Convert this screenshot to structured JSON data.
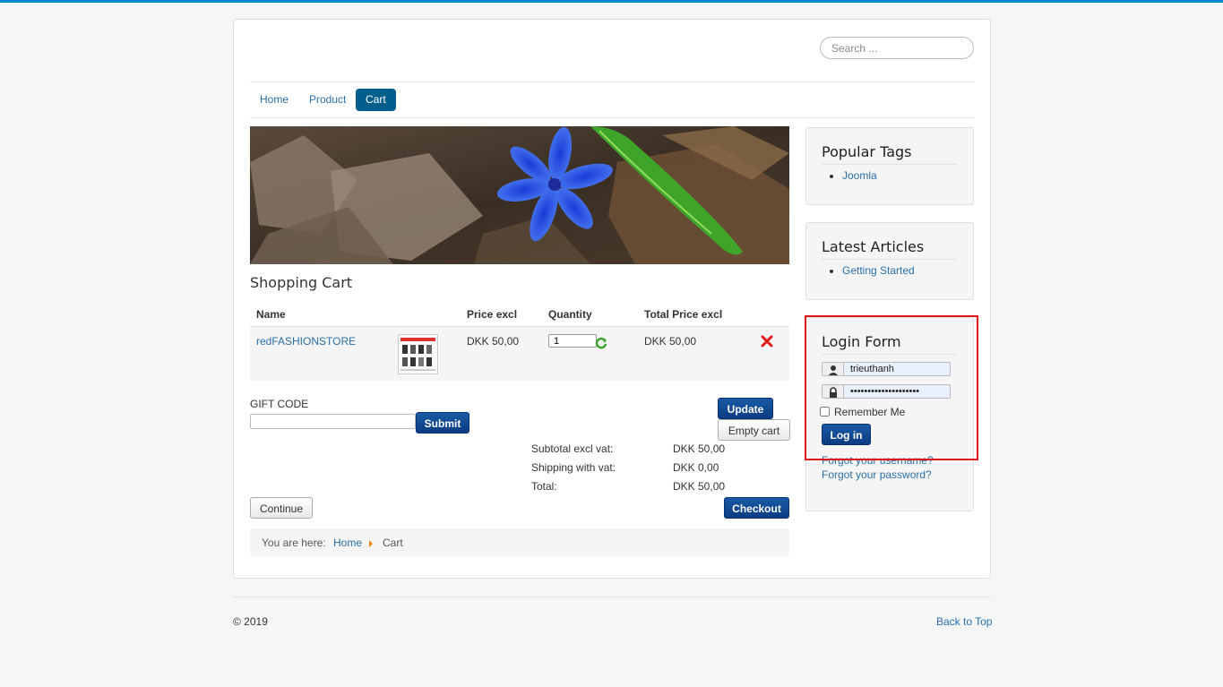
{
  "header": {
    "search_placeholder": "Search ..."
  },
  "nav": {
    "items": [
      {
        "label": "Home"
      },
      {
        "label": "Product"
      },
      {
        "label": "Cart"
      }
    ]
  },
  "cart": {
    "title": "Shopping Cart",
    "columns": {
      "name": "Name",
      "price": "Price excl",
      "quantity": "Quantity",
      "total": "Total Price excl"
    },
    "rows": [
      {
        "name": "redFASHIONSTORE",
        "price": "DKK 50,00",
        "quantity": "1",
        "total": "DKK 50,00"
      }
    ],
    "gift_code_label": "GIFT CODE",
    "submit_label": "Submit",
    "update_label": "Update",
    "empty_label": "Empty cart",
    "summary": [
      {
        "label": "Subtotal excl vat:",
        "value": "DKK 50,00"
      },
      {
        "label": "Shipping with vat:",
        "value": "DKK 0,00"
      },
      {
        "label": "Total:",
        "value": "DKK 50,00"
      }
    ],
    "continue_label": "Continue",
    "checkout_label": "Checkout"
  },
  "breadcrumbs": {
    "prefix": "You are here:",
    "home": "Home",
    "current": "Cart"
  },
  "sidebar": {
    "popular_tags": {
      "title": "Popular Tags",
      "items": [
        "Joomla"
      ]
    },
    "latest_articles": {
      "title": "Latest Articles",
      "items": [
        "Getting Started"
      ]
    },
    "login": {
      "title": "Login Form",
      "username": "trieuthanh",
      "password": "••••••••••••••••••••",
      "remember_label": "Remember Me",
      "login_label": "Log in",
      "forgot_username": "Forgot your username?",
      "forgot_password": "Forgot your password?"
    }
  },
  "footer": {
    "copyright": "© 2019",
    "back_to_top": "Back to Top"
  },
  "colors": {
    "accent": "#0088cc",
    "nav_active": "#005e8d",
    "button_primary": "#0b3c82",
    "highlight": "#e0161e"
  }
}
